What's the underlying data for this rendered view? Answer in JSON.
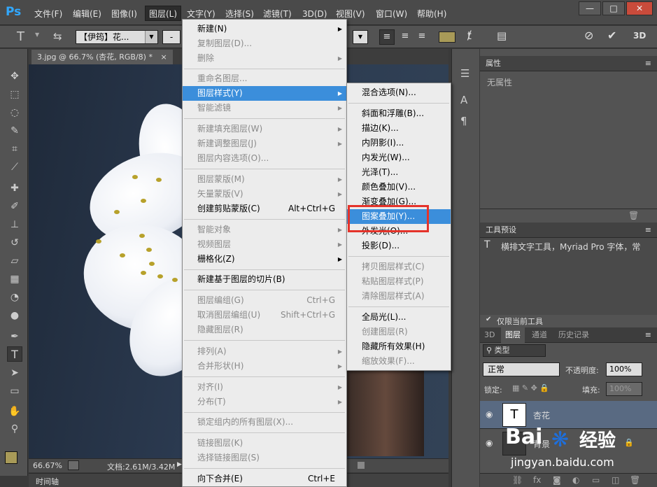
{
  "app": {
    "logo": "Ps"
  },
  "menubar": {
    "items": [
      "文件(F)",
      "编辑(E)",
      "图像(I)",
      "图层(L)",
      "文字(Y)",
      "选择(S)",
      "滤镜(T)",
      "3D(D)",
      "视图(V)",
      "窗口(W)",
      "帮助(H)"
    ],
    "active_index": 3
  },
  "window_controls": {
    "minimize": "—",
    "restore": "□",
    "close": "✕"
  },
  "options_bar": {
    "font_family": "【伊筠】花...",
    "dash": "-",
    "three_d_label": "3D"
  },
  "document": {
    "tab_title": "3.jpg @ 66.7% (杏花, RGB/8) *",
    "tab_close": "×"
  },
  "status_bar": {
    "zoom": "66.67%",
    "doc_info": "文档:2.61M/3.42M"
  },
  "timeline": {
    "label": "时间轴"
  },
  "layer_menu": {
    "items": [
      {
        "label": "新建(N)",
        "shortcut": "",
        "submenu": true,
        "disabled": false
      },
      {
        "label": "复制图层(D)...",
        "shortcut": "",
        "submenu": false,
        "disabled": true
      },
      {
        "label": "删除",
        "shortcut": "",
        "submenu": true,
        "disabled": true
      },
      {
        "label": "重命名图层...",
        "shortcut": "",
        "submenu": false,
        "disabled": true
      },
      {
        "label": "图层样式(Y)",
        "shortcut": "",
        "submenu": true,
        "disabled": false,
        "highlighted": true
      },
      {
        "label": "智能滤镜",
        "shortcut": "",
        "submenu": true,
        "disabled": true
      },
      {
        "label": "新建填充图层(W)",
        "shortcut": "",
        "submenu": true,
        "disabled": true
      },
      {
        "label": "新建调整图层(J)",
        "shortcut": "",
        "submenu": true,
        "disabled": true
      },
      {
        "label": "图层内容选项(O)...",
        "shortcut": "",
        "submenu": false,
        "disabled": true
      },
      {
        "label": "图层蒙版(M)",
        "shortcut": "",
        "submenu": true,
        "disabled": true
      },
      {
        "label": "矢量蒙版(V)",
        "shortcut": "",
        "submenu": true,
        "disabled": true
      },
      {
        "label": "创建剪贴蒙版(C)",
        "shortcut": "Alt+Ctrl+G",
        "submenu": false,
        "disabled": false
      },
      {
        "label": "智能对象",
        "shortcut": "",
        "submenu": true,
        "disabled": true
      },
      {
        "label": "视频图层",
        "shortcut": "",
        "submenu": true,
        "disabled": true
      },
      {
        "label": "栅格化(Z)",
        "shortcut": "",
        "submenu": true,
        "disabled": false
      },
      {
        "label": "新建基于图层的切片(B)",
        "shortcut": "",
        "submenu": false,
        "disabled": false
      },
      {
        "label": "图层编组(G)",
        "shortcut": "Ctrl+G",
        "submenu": false,
        "disabled": true
      },
      {
        "label": "取消图层编组(U)",
        "shortcut": "Shift+Ctrl+G",
        "submenu": false,
        "disabled": true
      },
      {
        "label": "隐藏图层(R)",
        "shortcut": "",
        "submenu": false,
        "disabled": true
      },
      {
        "label": "排列(A)",
        "shortcut": "",
        "submenu": true,
        "disabled": true
      },
      {
        "label": "合并形状(H)",
        "shortcut": "",
        "submenu": true,
        "disabled": true
      },
      {
        "label": "对齐(I)",
        "shortcut": "",
        "submenu": true,
        "disabled": true
      },
      {
        "label": "分布(T)",
        "shortcut": "",
        "submenu": true,
        "disabled": true
      },
      {
        "label": "锁定组内的所有图层(X)...",
        "shortcut": "",
        "submenu": false,
        "disabled": true
      },
      {
        "label": "链接图层(K)",
        "shortcut": "",
        "submenu": false,
        "disabled": true
      },
      {
        "label": "选择链接图层(S)",
        "shortcut": "",
        "submenu": false,
        "disabled": true
      },
      {
        "label": "向下合并(E)",
        "shortcut": "Ctrl+E",
        "submenu": false,
        "disabled": false
      }
    ]
  },
  "style_submenu": {
    "items": [
      {
        "label": "混合选项(N)...",
        "disabled": false
      },
      {
        "label": "斜面和浮雕(B)...",
        "disabled": false
      },
      {
        "label": "描边(K)...",
        "disabled": false
      },
      {
        "label": "内阴影(I)...",
        "disabled": false
      },
      {
        "label": "内发光(W)...",
        "disabled": false
      },
      {
        "label": "光泽(T)...",
        "disabled": false
      },
      {
        "label": "颜色叠加(V)...",
        "disabled": false
      },
      {
        "label": "渐变叠加(G)...",
        "disabled": false
      },
      {
        "label": "图案叠加(Y)...",
        "disabled": false,
        "highlighted": true
      },
      {
        "label": "外发光(O)...",
        "disabled": false
      },
      {
        "label": "投影(D)...",
        "disabled": false
      },
      {
        "label": "拷贝图层样式(C)",
        "disabled": true
      },
      {
        "label": "粘贴图层样式(P)",
        "disabled": true
      },
      {
        "label": "清除图层样式(A)",
        "disabled": true
      },
      {
        "label": "全局光(L)...",
        "disabled": false
      },
      {
        "label": "创建图层(R)",
        "disabled": true
      },
      {
        "label": "隐藏所有效果(H)",
        "disabled": false
      },
      {
        "label": "缩放效果(F)...",
        "disabled": true
      }
    ]
  },
  "properties_panel": {
    "title": "属性",
    "empty_text": "无属性"
  },
  "tool_presets_panel": {
    "title": "工具预设",
    "preset_text": "横排文字工具，Myriad Pro 字体，常规",
    "current_only": "仅限当前工具"
  },
  "layers_panel": {
    "tabs": [
      "3D",
      "图层",
      "通道",
      "历史记录"
    ],
    "active_tab": 1,
    "filter_label": "类型",
    "blend_mode": "正常",
    "opacity_label": "不透明度:",
    "opacity_value": "100%",
    "lock_label": "锁定:",
    "fill_label": "填充:",
    "fill_value": "100%",
    "layers": [
      {
        "name": "杏花",
        "type": "text",
        "thumb": "T"
      },
      {
        "name": "背景",
        "type": "image",
        "thumb": ""
      }
    ]
  },
  "watermark": {
    "brand": "Bai",
    "brand2": "经验",
    "url": "jingyan.baidu.com"
  },
  "colors": {
    "accent": "#3b8edb",
    "highlight_box": "#e5332a",
    "foreground": "#a89a58",
    "background": "#ffffff"
  }
}
